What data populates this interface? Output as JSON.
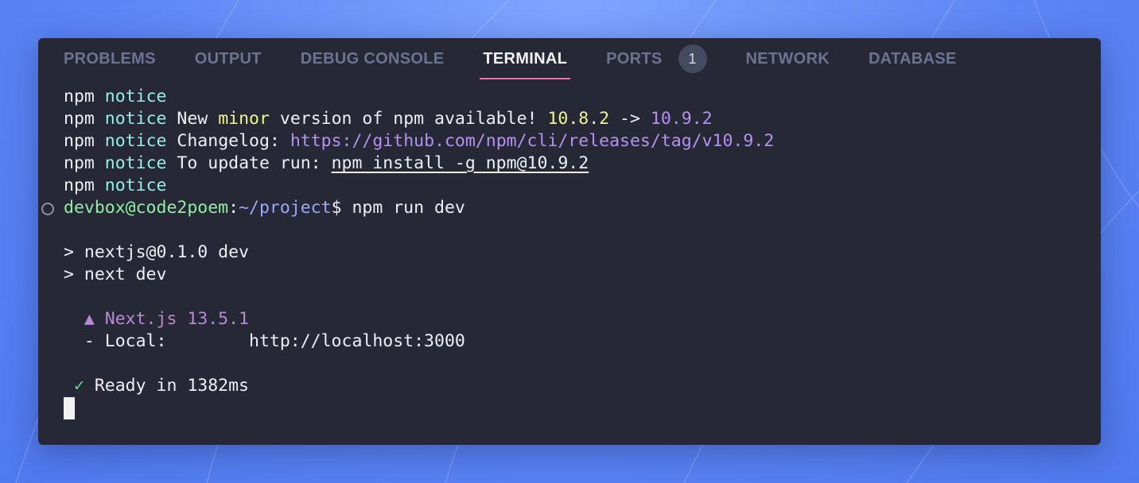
{
  "colors": {
    "accent_underline": "#f06fa8",
    "terminal_bg": "#262836",
    "notice": "#8ff0ea",
    "version_highlight": "#f2f589",
    "link": "#b591f7",
    "user_host": "#8ef0a2",
    "path": "#98a9ff",
    "check": "#5fe08c"
  },
  "tabs": [
    {
      "label": "PROBLEMS"
    },
    {
      "label": "OUTPUT"
    },
    {
      "label": "DEBUG CONSOLE"
    },
    {
      "label": "TERMINAL",
      "active": true
    },
    {
      "label": "PORTS",
      "badge": "1"
    },
    {
      "label": "NETWORK"
    },
    {
      "label": "DATABASE"
    }
  ],
  "terminal": {
    "npm": "npm",
    "notice": "notice",
    "l2": {
      "a": " New ",
      "minor": "minor",
      "b": " version of npm available! ",
      "old": "10.8.2",
      "arrow": " -> ",
      "new": "10.9.2"
    },
    "l3": {
      "a": " Changelog: ",
      "url": "https://github.com/npm/cli/releases/tag/v10.9.2"
    },
    "l4": {
      "a": " To update run: ",
      "cmd": "npm install -g npm@10.9.2"
    },
    "prompt": {
      "user": "devbox@code2poem",
      "colon": ":",
      "path": "~/project",
      "dollar": "$ ",
      "cmd": "npm run dev"
    },
    "script1": "> nextjs@0.1.0 dev",
    "script2": "> next dev",
    "next_version": "  ▲ Next.js 13.5.1",
    "local_label": "  - Local:        ",
    "local_url": "http://localhost:3000",
    "check": " ✓",
    "ready": " Ready in 1382ms"
  }
}
